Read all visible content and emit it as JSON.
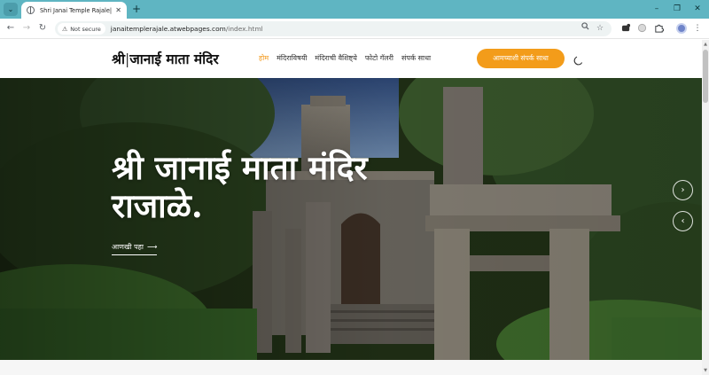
{
  "browser": {
    "tab_search_icon": "chevron-down-icon",
    "tab_title": "Shri Janai Temple Rajale| Home",
    "tab_close": "✕",
    "new_tab": "+",
    "window_controls": {
      "minimize": "–",
      "restore": "❐",
      "close": "✕"
    },
    "nav": {
      "back": "←",
      "forward": "→",
      "reload": "↻"
    },
    "security_label": "Not secure",
    "url_host": "janaitemplerajale.atwebpages.com",
    "url_path": "/index.html",
    "icons": [
      "search-icon",
      "bookmark-star-icon",
      "extension-icon",
      "puzzle-icon",
      "profile-avatar"
    ]
  },
  "site": {
    "brand_part1": "श्री",
    "brand_bar": "|",
    "brand_part2": "जानाई माता मंदिर",
    "nav": [
      {
        "label": "होम",
        "active": true
      },
      {
        "label": "मंदिराविषयी",
        "active": false
      },
      {
        "label": "मंदिराची वैशिष्ट्ये",
        "active": false
      },
      {
        "label": "फोटो गॅलरी",
        "active": false
      },
      {
        "label": "संपर्क साधा",
        "active": false
      }
    ],
    "cta_label": "आमच्याशी संपर्क साधा",
    "accent_color": "#f39c1a"
  },
  "hero": {
    "title_line1": "श्री जानाई माता मंदिर",
    "title_line2": "राजाळे.",
    "link_label": "आणखी पहा",
    "link_arrow": "⟶",
    "next_label": "›",
    "prev_label": "‹"
  }
}
